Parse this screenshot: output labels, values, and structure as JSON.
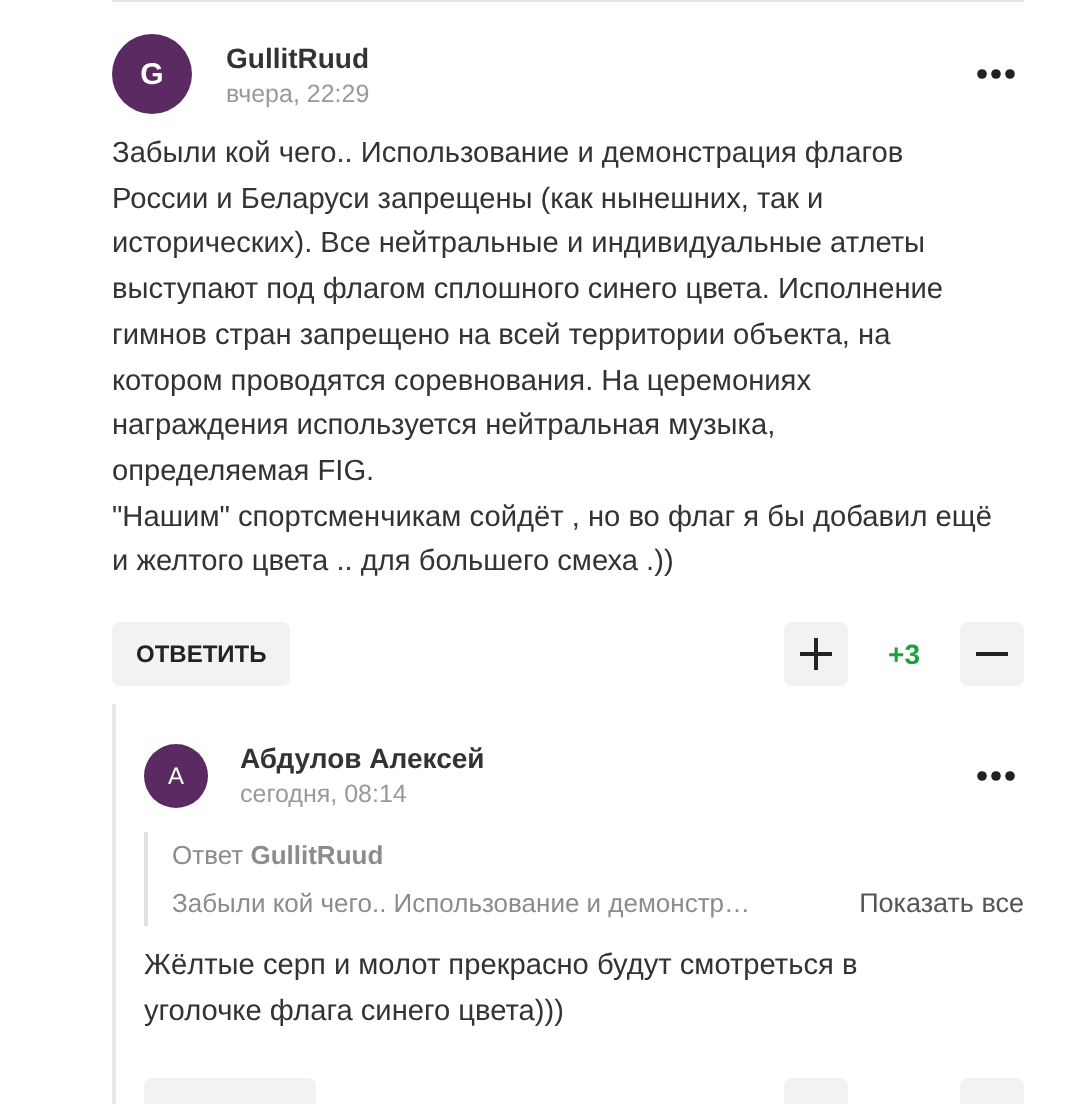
{
  "comments": [
    {
      "author": "GullitRuud",
      "initial": "G",
      "time": "вчера, 22:29",
      "lines": [
        "Забыли кой чего.. Использование и демонстрация флагов",
        "России и Беларуси запрещены (как нынешних, так и",
        "исторических). Все нейтральные и индивидуальные атлеты",
        "выступают под флагом сплошного синего цвета. Исполнение",
        "гимнов стран запрещено на всей территории объекта, на",
        "котором проводятся соревнования. На церемониях",
        "награждения используется нейтральная музыка,",
        "определяемая FIG.",
        "\"Нашим\" спортсменчикам сойдёт , но во флаг я бы добавил ещё",
        "и желтого цвета .. для большего смеха .))"
      ],
      "reply_label": "ОТВЕТИТЬ",
      "score": "+3",
      "children": [
        {
          "author": "Абдулов Алексей",
          "initial": "А",
          "time": "сегодня, 08:14",
          "quote": {
            "prefix": "Ответ",
            "author": "GullitRuud",
            "excerpt": "Забыли кой чего.. Использование и демонстр…",
            "show_all": "Показать все"
          },
          "lines": [
            "Жёлтые серп и молот прекрасно будут смотреться в",
            "уголочке флага синего цвета)))"
          ]
        }
      ]
    }
  ]
}
